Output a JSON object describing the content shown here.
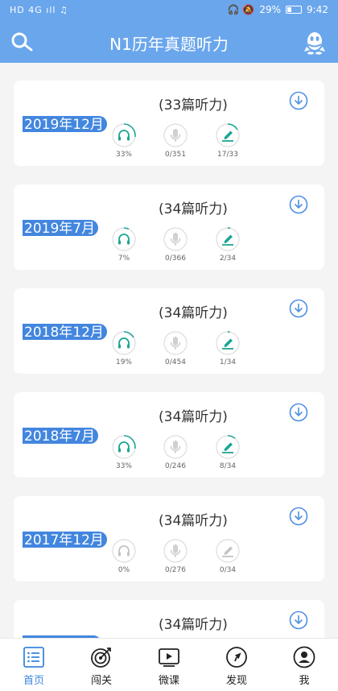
{
  "status_bar": {
    "left": "HD 4G ıll ♫",
    "right_icons": "🎧 🔕",
    "battery": "29%",
    "time": "9:42"
  },
  "header": {
    "title": "N1历年真题听力",
    "search_icon": "search-icon",
    "qq_icon": "qq-penguin-icon"
  },
  "colors": {
    "primary": "#6aa6ec",
    "tag": "#4286df",
    "teal": "#1ba593",
    "muted": "#bdbdbd",
    "accent_blue": "#3b86de"
  },
  "cards": [
    {
      "count": "(33篇听力)",
      "date": "2019年12月",
      "listen": "33%",
      "audio": "0/351",
      "quiz": "17/33"
    },
    {
      "count": "(34篇听力)",
      "date": "2019年7月",
      "listen": "7%",
      "audio": "0/366",
      "quiz": "2/34"
    },
    {
      "count": "(34篇听力)",
      "date": "2018年12月",
      "listen": "19%",
      "audio": "0/454",
      "quiz": "1/34"
    },
    {
      "count": "(34篇听力)",
      "date": "2018年7月",
      "listen": "33%",
      "audio": "0/246",
      "quiz": "8/34"
    },
    {
      "count": "(34篇听力)",
      "date": "2017年12月",
      "listen": "0%",
      "audio": "0/276",
      "quiz": "0/34"
    },
    {
      "count": "(34篇听力)",
      "date": "",
      "listen": "",
      "audio": "",
      "quiz": ""
    }
  ],
  "nav": [
    {
      "label": "首页",
      "icon": "home-list-icon"
    },
    {
      "label": "闯关",
      "icon": "target-icon"
    },
    {
      "label": "微课",
      "icon": "video-play-icon"
    },
    {
      "label": "发现",
      "icon": "compass-arrow-icon"
    },
    {
      "label": "我",
      "icon": "user-icon"
    }
  ]
}
